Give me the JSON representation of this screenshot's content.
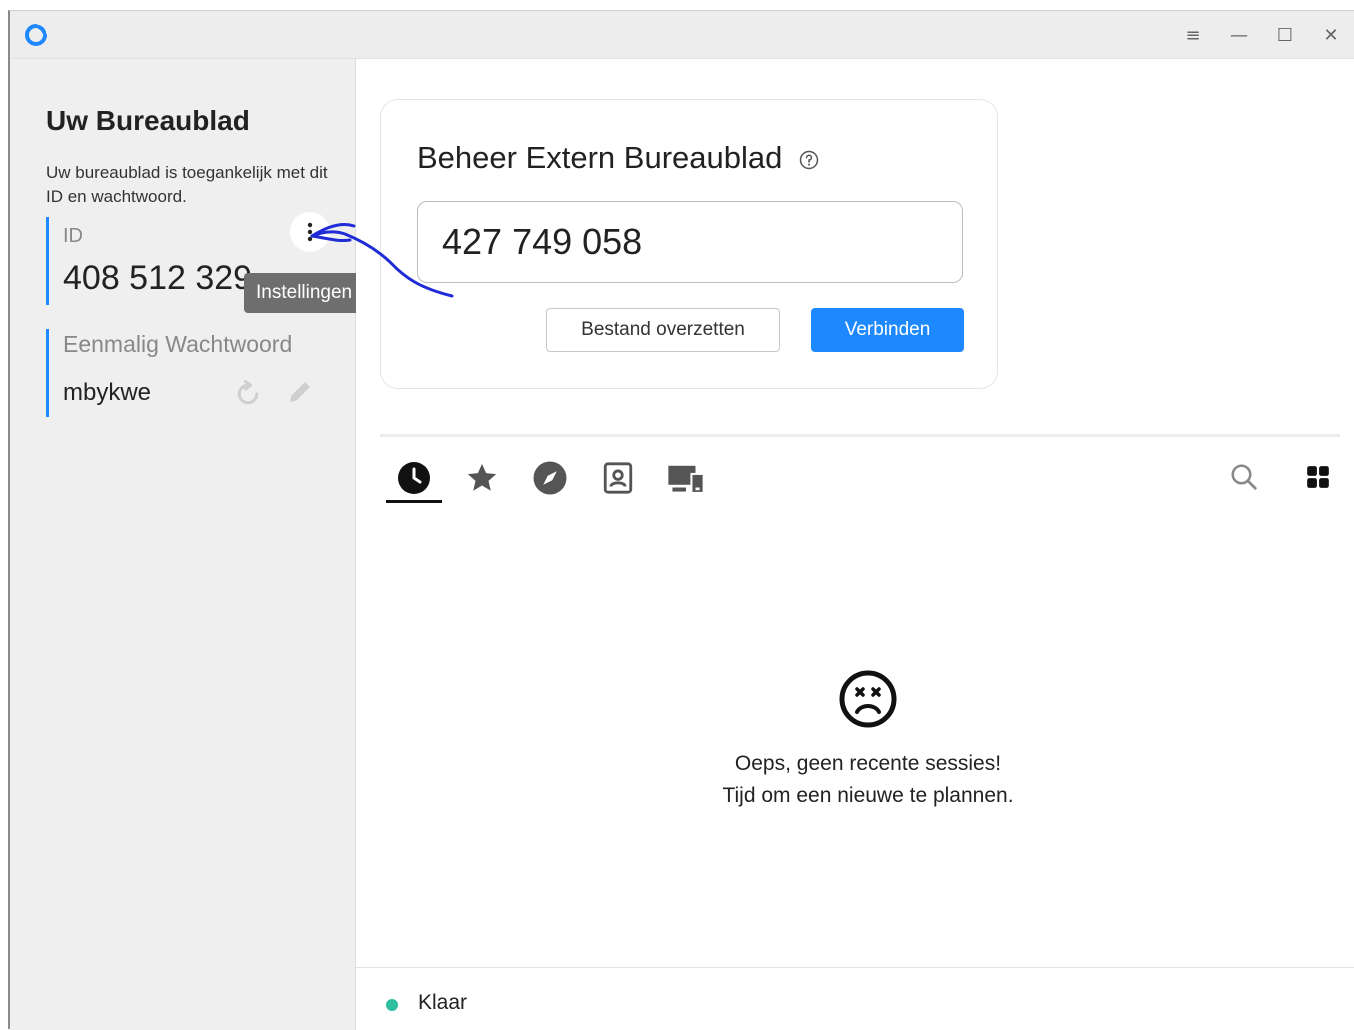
{
  "window": {
    "controls": {
      "menu": "≡",
      "minimize": "—",
      "maximize": "☐",
      "close": "✕"
    }
  },
  "sidebar": {
    "title": "Uw Bureaublad",
    "description": "Uw bureaublad is toegankelijk met dit ID en wachtwoord.",
    "id_label": "ID",
    "id_value": "408 512 329",
    "tooltip": "Instellingen",
    "password_label": "Eenmalig Wachtwoord",
    "password_value": "mbykwe"
  },
  "connect": {
    "title": "Beheer Extern Bureaublad",
    "remote_id": "427 749 058",
    "transfer_button": "Bestand overzetten",
    "connect_button": "Verbinden"
  },
  "tabs": [
    {
      "icon": "clock-icon",
      "active": true
    },
    {
      "icon": "star-icon",
      "active": false
    },
    {
      "icon": "compass-icon",
      "active": false
    },
    {
      "icon": "address-book-icon",
      "active": false
    },
    {
      "icon": "devices-icon",
      "active": false
    }
  ],
  "empty_state": {
    "line1": "Oeps, geen recente sessies!",
    "line2": "Tijd om een nieuwe te plannen."
  },
  "status": {
    "text": "Klaar",
    "color": "#2fbfa0"
  },
  "colors": {
    "accent": "#1e88ff",
    "annotation": "#1f2bd6"
  }
}
